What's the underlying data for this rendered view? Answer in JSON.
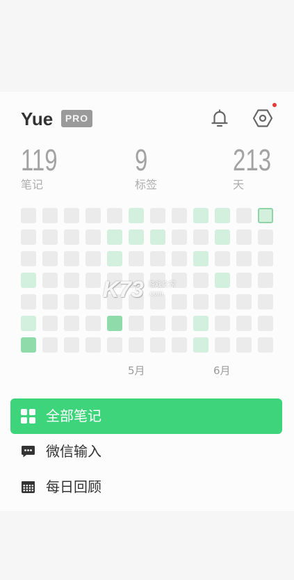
{
  "header": {
    "username": "Yue",
    "badge": "PRO",
    "notification_dot_color": "#e53935"
  },
  "icons": {
    "notifications": "bell-icon",
    "settings": "hexagon-settings-icon"
  },
  "stats": [
    {
      "value": "119",
      "label": "笔记"
    },
    {
      "value": "9",
      "label": "标签"
    },
    {
      "value": "213",
      "label": "天"
    }
  ],
  "heatmap": {
    "levels": [
      [
        0,
        0,
        0,
        0,
        0,
        1,
        0,
        0,
        1,
        1,
        0,
        1
      ],
      [
        0,
        0,
        0,
        0,
        1,
        1,
        1,
        0,
        0,
        1,
        0,
        0
      ],
      [
        0,
        0,
        0,
        0,
        1,
        0,
        0,
        0,
        1,
        0,
        0,
        0
      ],
      [
        1,
        0,
        0,
        0,
        0,
        0,
        0,
        0,
        0,
        1,
        0,
        0
      ],
      [
        0,
        0,
        0,
        0,
        0,
        0,
        0,
        0,
        0,
        0,
        0,
        0
      ],
      [
        1,
        0,
        0,
        0,
        2,
        0,
        0,
        0,
        1,
        0,
        0,
        0
      ],
      [
        2,
        0,
        0,
        0,
        0,
        0,
        0,
        0,
        1,
        0,
        0,
        0
      ]
    ],
    "today": {
      "row": 0,
      "col": 11
    },
    "month_labels": [
      "5月",
      "6月"
    ],
    "colors": {
      "empty": "#ebebeb",
      "level1": "#d3f0de",
      "level2": "#8fdcaa",
      "today_border": "#8fd4a7"
    }
  },
  "menu": {
    "items": [
      {
        "label": "全部笔记",
        "icon": "grid-icon",
        "active": true
      },
      {
        "label": "微信输入",
        "icon": "chat-icon",
        "active": false
      },
      {
        "label": "每日回顾",
        "icon": "calendar-icon",
        "active": false
      }
    ]
  },
  "theme": {
    "accent": "#3ed47b",
    "text": "#333333",
    "muted": "#a3a3a3"
  },
  "watermark": {
    "logo": "K73",
    "name": "游戏之家",
    "domain": ".com"
  }
}
